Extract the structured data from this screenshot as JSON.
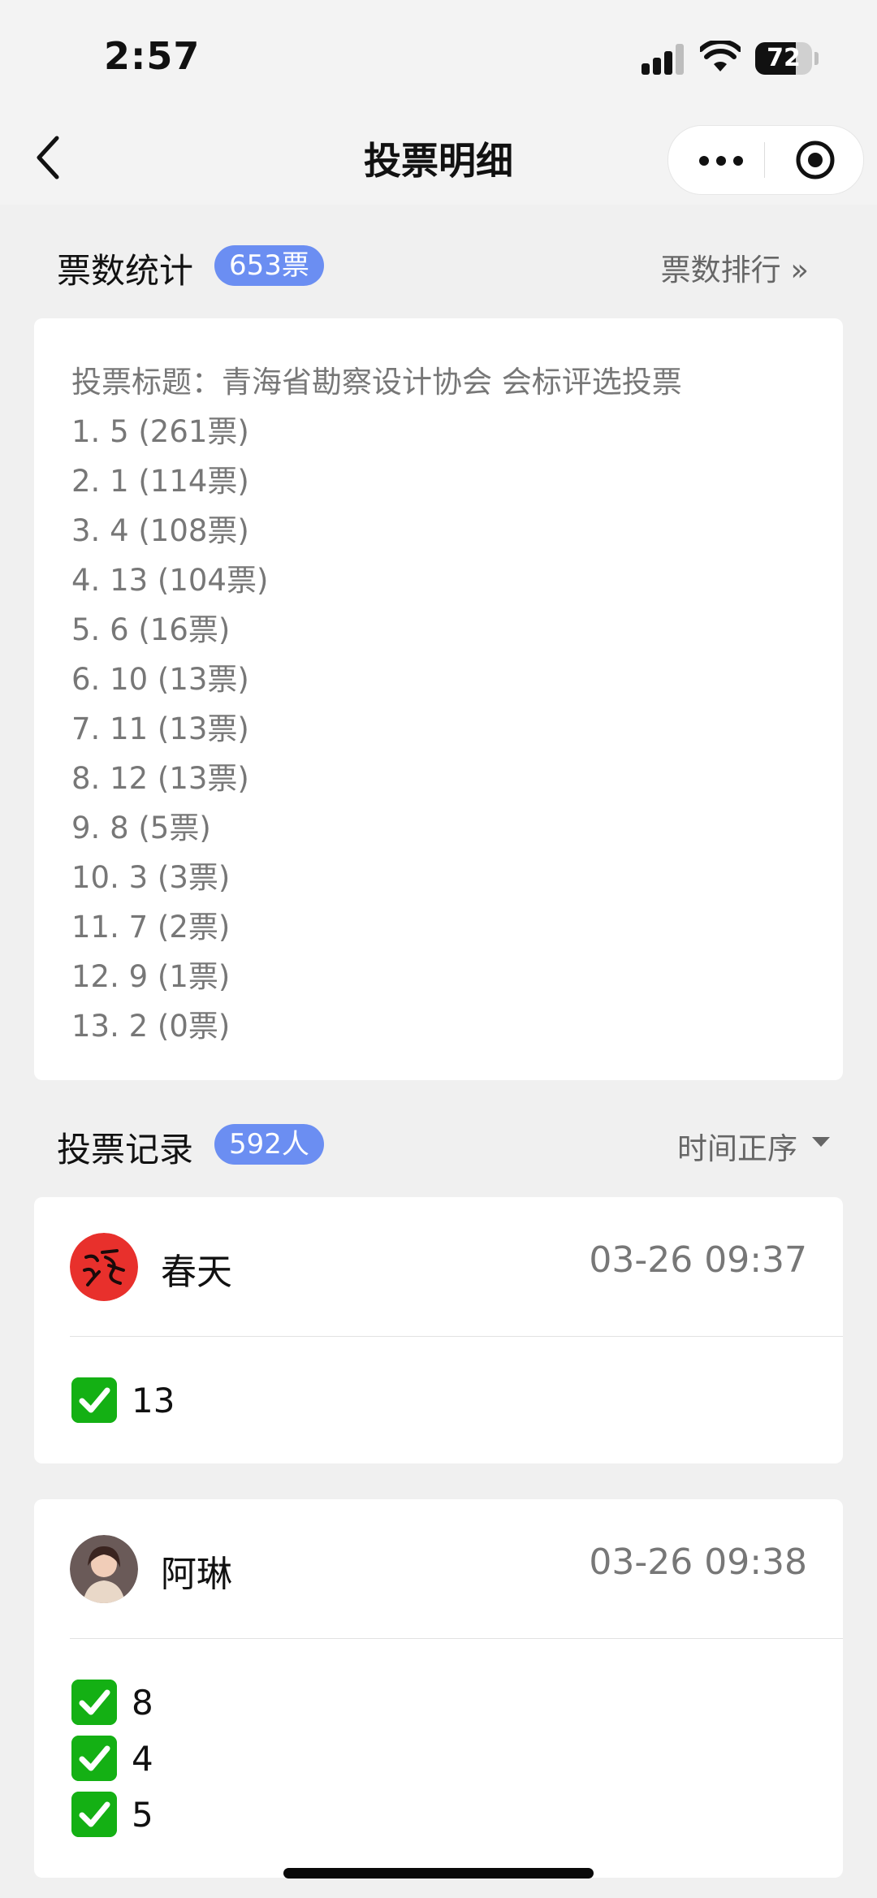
{
  "status": {
    "time": "2:57",
    "battery": "72",
    "battery_level": 0.72
  },
  "nav": {
    "title": "投票明细"
  },
  "stats": {
    "title": "票数统计",
    "badge": "653票",
    "right_link": "票数排行 »",
    "vote_title": "投票标题：青海省勘察设计协会 会标评选投票",
    "lines": [
      "1. 5 (261票)",
      "2. 1 (114票)",
      "3. 4 (108票)",
      "4. 13 (104票)",
      "5. 6 (16票)",
      "6. 10 (13票)",
      "7. 11 (13票)",
      "8. 12 (13票)",
      "9. 8 (5票)",
      "10. 3 (3票)",
      "11. 7 (2票)",
      "12. 9 (1票)",
      "13. 2 (0票)"
    ]
  },
  "records": {
    "title": "投票记录",
    "badge": "592人",
    "sort_label": "时间正序",
    "items": [
      {
        "name": "春天",
        "time": "03-26 09:37",
        "choices": [
          "13"
        ]
      },
      {
        "name": "阿琳",
        "time": "03-26 09:38",
        "choices": [
          "8",
          "4",
          "5"
        ]
      }
    ]
  }
}
